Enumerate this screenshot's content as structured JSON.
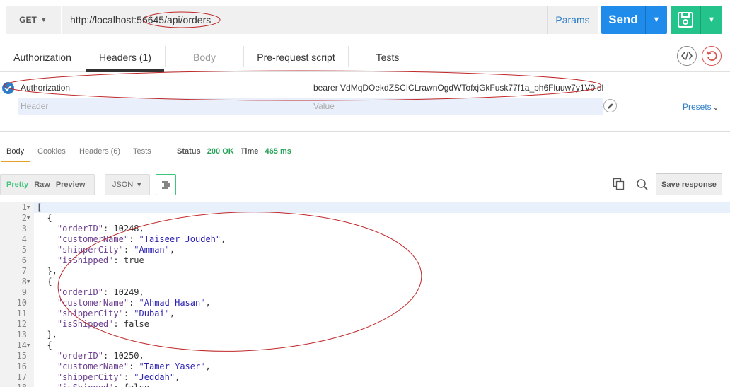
{
  "request": {
    "method": "GET",
    "url": "http://localhost:56645/api/orders",
    "params_label": "Params",
    "send_label": "Send"
  },
  "request_tabs": [
    {
      "label": "Authorization"
    },
    {
      "label": "Headers (1)"
    },
    {
      "label": "Body"
    },
    {
      "label": "Pre-request script"
    },
    {
      "label": "Tests"
    }
  ],
  "headers": {
    "rows": [
      {
        "key": "Authorization",
        "value": "bearer VdMqDOekdZSCICLrawnOgdWTofxjGkFusk77f1a_ph6Fluuw7y1V0idl"
      }
    ],
    "key_placeholder": "Header",
    "value_placeholder": "Value",
    "presets_label": "Presets"
  },
  "response_tabs": [
    {
      "label": "Body"
    },
    {
      "label": "Cookies"
    },
    {
      "label": "Headers (6)"
    },
    {
      "label": "Tests"
    }
  ],
  "response_meta": {
    "status_label": "Status",
    "status_value": "200 OK",
    "time_label": "Time",
    "time_value": "465 ms"
  },
  "response_toolbar": {
    "modes": [
      "Pretty",
      "Raw",
      "Preview"
    ],
    "format": "JSON",
    "save_label": "Save response"
  },
  "orders": [
    {
      "orderID": 10248,
      "customerName": "Taiseer Joudeh",
      "shipperCity": "Amman",
      "isShipped": true
    },
    {
      "orderID": 10249,
      "customerName": "Ahmad Hasan",
      "shipperCity": "Dubai",
      "isShipped": false
    },
    {
      "orderID": 10250,
      "customerName": "Tamer Yaser",
      "shipperCity": "Jeddah",
      "isShipped": false
    }
  ],
  "colors": {
    "send": "#1f8ceb",
    "save": "#24c38c",
    "status_ok": "#2aa35a",
    "annotation": "#c0282a"
  }
}
